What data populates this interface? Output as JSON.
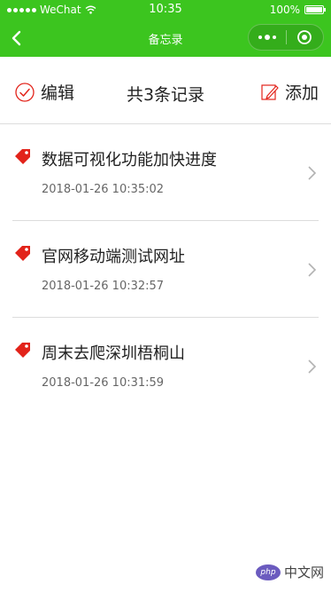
{
  "status_bar": {
    "carrier": "WeChat",
    "time": "10:35",
    "battery": "100%"
  },
  "nav": {
    "title": "备忘录",
    "icons": [
      "back-arrow",
      "more-dots",
      "close-circle"
    ]
  },
  "toolbar": {
    "edit_label": "编辑",
    "count_label": "共3条记录",
    "add_label": "添加",
    "icons": [
      "check-circle-icon",
      "edit-pencil-icon"
    ]
  },
  "memos": [
    {
      "title": "数据可视化功能加快进度",
      "time": "2018-01-26 10:35:02"
    },
    {
      "title": "官网移动端测试网址",
      "time": "2018-01-26 10:32:57"
    },
    {
      "title": "周末去爬深圳梧桐山",
      "time": "2018-01-26 10:31:59"
    }
  ],
  "watermark": {
    "logo_text": "php",
    "text": "中文网"
  },
  "colors": {
    "brand_green": "#3cc51f",
    "tag_red": "#e2231a"
  }
}
